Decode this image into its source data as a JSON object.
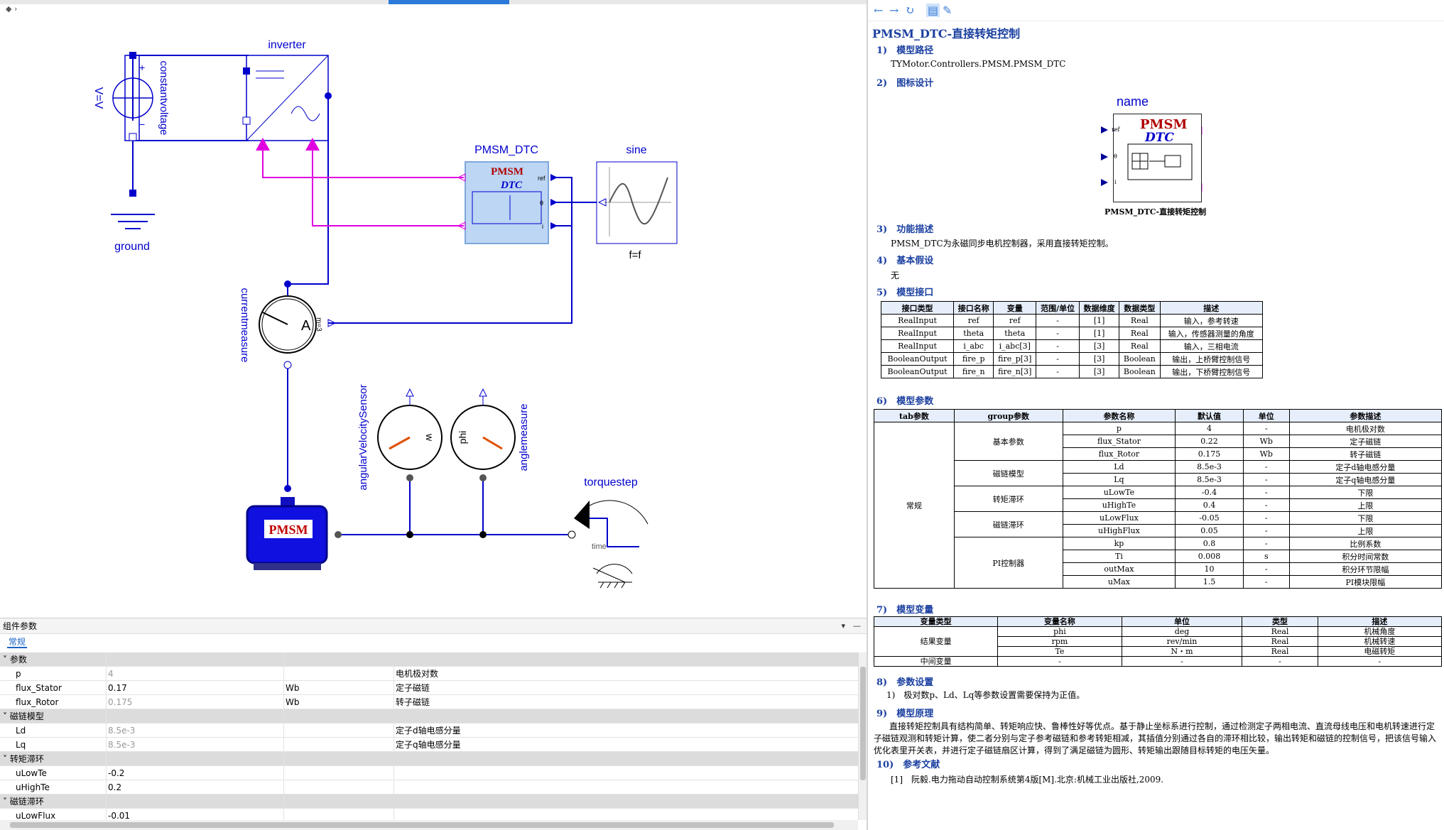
{
  "diagram": {
    "labels": {
      "inverter": "inverter",
      "constantvoltage": "constantvoltage",
      "v_eq": "V=V",
      "ground": "ground",
      "pmsm_dtc": "PMSM_DTC",
      "sine": "sine",
      "f_eq": "f=f",
      "currentmeasure": "currentmeasure",
      "m_eq": "m=3",
      "ammeter_a": "A",
      "angular_velocity_sensor": "angularVelocitySensor",
      "anglemeasure": "anglemeasure",
      "w_label": "w",
      "phi_label": "phi",
      "torquestep": "torquestep",
      "time_label": "time",
      "pmsm_block": "PMSM",
      "dtc_pmsm": "PMSM",
      "dtc_dtc": "DTC",
      "port_ref": "ref",
      "port_theta": "θ",
      "port_i": "i"
    }
  },
  "params_panel": {
    "title": "组件参数",
    "tab": "常规",
    "groups": [
      {
        "name": "参数",
        "rows": [
          {
            "name": "p",
            "value": "4",
            "unit": "",
            "desc": "电机极对数",
            "disabled": true
          },
          {
            "name": "flux_Stator",
            "value": "0.17",
            "unit": "Wb",
            "desc": "定子磁链",
            "disabled": false
          },
          {
            "name": "flux_Rotor",
            "value": "0.175",
            "unit": "Wb",
            "desc": "转子磁链",
            "disabled": true
          }
        ]
      },
      {
        "name": "磁链模型",
        "rows": [
          {
            "name": "Ld",
            "value": "8.5e-3",
            "unit": "",
            "desc": "定子d轴电感分量",
            "disabled": true
          },
          {
            "name": "Lq",
            "value": "8.5e-3",
            "unit": "",
            "desc": "定子q轴电感分量",
            "disabled": true
          }
        ]
      },
      {
        "name": "转矩滞环",
        "rows": [
          {
            "name": "uLowTe",
            "value": "-0.2",
            "unit": "",
            "desc": "",
            "disabled": false
          },
          {
            "name": "uHighTe",
            "value": "0.2",
            "unit": "",
            "desc": "",
            "disabled": false
          }
        ]
      },
      {
        "name": "磁链滞环",
        "rows": [
          {
            "name": "uLowFlux",
            "value": "-0.01",
            "unit": "",
            "desc": "",
            "disabled": false
          }
        ]
      }
    ]
  },
  "doc": {
    "title": "PMSM_DTC-直接转矩控制",
    "sections": {
      "s1": "1)　模型路径",
      "s2": "2)　图标设计",
      "s3": "3)　功能描述",
      "s4": "4)　基本假设",
      "s5": "5)　模型接口",
      "s6": "6)　模型参数",
      "s7": "7)　模型变量",
      "s8": "8)　参数设置",
      "s9": "9)　模型原理",
      "s10": "10)　参考文献"
    },
    "model_path": "TYMotor.Controllers.PMSM.PMSM_DTC",
    "icon_name": "name",
    "icon_caption": "PMSM_DTC-直接转矩控制",
    "icon_pmsm": "PMSM",
    "icon_dtc": "DTC",
    "icon_ref": "ref",
    "icon_theta": "θ",
    "icon_i": "i",
    "function_desc": "PMSM_DTC为永磁同步电机控制器，采用直接转矩控制。",
    "assumption": "无",
    "interface_headers": [
      "接口类型",
      "接口名称",
      "变量",
      "范围/单位",
      "数据维度",
      "数据类型",
      "描述"
    ],
    "interface_rows": [
      [
        "RealInput",
        "ref",
        "ref",
        "-",
        "[1]",
        "Real",
        "输入，参考转速"
      ],
      [
        "RealInput",
        "theta",
        "theta",
        "-",
        "[1]",
        "Real",
        "输入，传感器测量的角度"
      ],
      [
        "RealInput",
        "i_abc",
        "i_abc[3]",
        "-",
        "[3]",
        "Real",
        "输入，三相电流"
      ],
      [
        "BooleanOutput",
        "fire_p",
        "fire_p[3]",
        "-",
        "[3]",
        "Boolean",
        "输出，上桥臂控制信号"
      ],
      [
        "BooleanOutput",
        "fire_n",
        "fire_n[3]",
        "-",
        "[3]",
        "Boolean",
        "输出，下桥臂控制信号"
      ]
    ],
    "param_headers": [
      "tab参数",
      "group参数",
      "参数名称",
      "默认值",
      "单位",
      "参数描述"
    ],
    "param_tab": "常规",
    "param_groups": [
      {
        "name": "基本参数",
        "rows": [
          [
            "p",
            "4",
            "-",
            "电机极对数"
          ],
          [
            "flux_Stator",
            "0.22",
            "Wb",
            "定子磁链"
          ],
          [
            "flux_Rotor",
            "0.175",
            "Wb",
            "转子磁链"
          ]
        ]
      },
      {
        "name": "磁链模型",
        "rows": [
          [
            "Ld",
            "8.5e-3",
            "-",
            "定子d轴电感分量"
          ],
          [
            "Lq",
            "8.5e-3",
            "-",
            "定子q轴电感分量"
          ]
        ]
      },
      {
        "name": "转矩滞环",
        "rows": [
          [
            "uLowTe",
            "-0.4",
            "-",
            "下限"
          ],
          [
            "uHighTe",
            "0.4",
            "-",
            "上限"
          ]
        ]
      },
      {
        "name": "磁链滞环",
        "rows": [
          [
            "uLowFlux",
            "-0.05",
            "-",
            "下限"
          ],
          [
            "uHighFlux",
            "0.05",
            "-",
            "上限"
          ]
        ]
      },
      {
        "name": "PI控制器",
        "rows": [
          [
            "kp",
            "0.8",
            "-",
            "比例系数"
          ],
          [
            "Ti",
            "0.008",
            "s",
            "积分时间常数"
          ],
          [
            "outMax",
            "10",
            "-",
            "积分环节限幅"
          ],
          [
            "uMax",
            "1.5",
            "-",
            "PI模块限幅"
          ]
        ]
      }
    ],
    "var_headers": [
      "变量类型",
      "变量名称",
      "单位",
      "类型",
      "描述"
    ],
    "var_group1": "结果变量",
    "var_rows": [
      [
        "phi",
        "deg",
        "Real",
        "机械角度"
      ],
      [
        "rpm",
        "rev/min",
        "Real",
        "机械转速"
      ],
      [
        "Te",
        "N・m",
        "Real",
        "电磁转矩"
      ]
    ],
    "var_group2": "中间变量",
    "var_row2": [
      "-",
      "-",
      "-",
      "-"
    ],
    "param_setting": "1)　极对数p、Ld、Lq等参数设置需要保持为正值。",
    "principle": "直接转矩控制具有结构简单、转矩响应快、鲁棒性好等优点。基于静止坐标系进行控制，通过检测定子两相电流、直流母线电压和电机转速进行定子磁链观测和转矩计算，使二者分别与定子参考磁链和参考转矩相减，其插值分别通过各自的滞环相比较，输出转矩和磁链的控制信号，把该信号输入优化表里开关表，并进行定子磁链扇区计算，得到了满足磁链为圆形、转矩输出跟随目标转矩的电压矢量。",
    "reference": "[1]　阮毅.电力拖动自动控制系统第4版[M].北京:机械工业出版社,2009."
  }
}
